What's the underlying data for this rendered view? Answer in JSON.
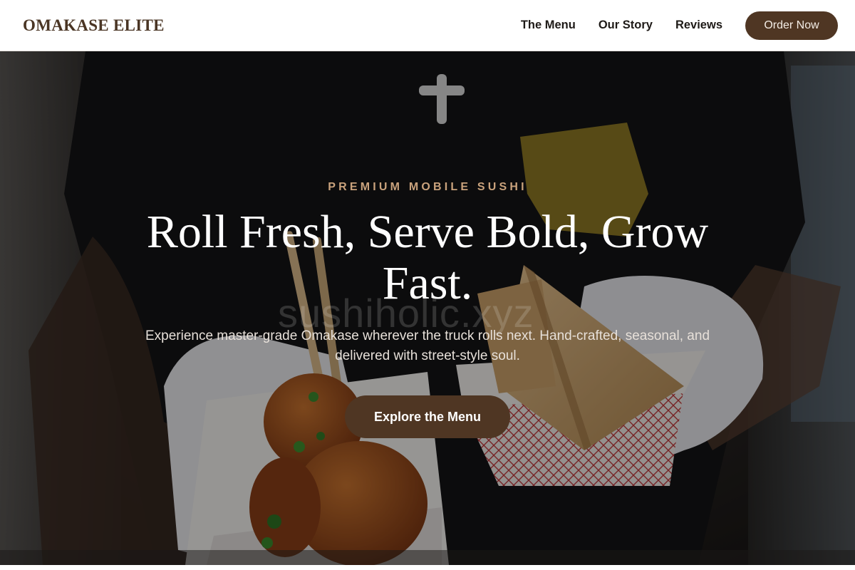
{
  "header": {
    "brand": "OMAKASE ELITE",
    "nav": [
      {
        "label": "The Menu"
      },
      {
        "label": "Our Story"
      },
      {
        "label": "Reviews"
      }
    ],
    "cta_label": "Order Now"
  },
  "hero": {
    "eyebrow": "PREMIUM MOBILE SUSHI",
    "headline": "Roll Fresh, Serve Bold, Grow Fast.",
    "watermark": "sushiholic.xyz",
    "subtitle": "Experience master-grade Omakase wherever the truck rolls next. Hand-crafted, seasonal, and delivered with street-style soul.",
    "cta_label": "Explore the Menu"
  },
  "colors": {
    "brand_brown": "#4f3623",
    "eyebrow_gold": "#c9a27c",
    "header_bg": "#ffffff"
  }
}
